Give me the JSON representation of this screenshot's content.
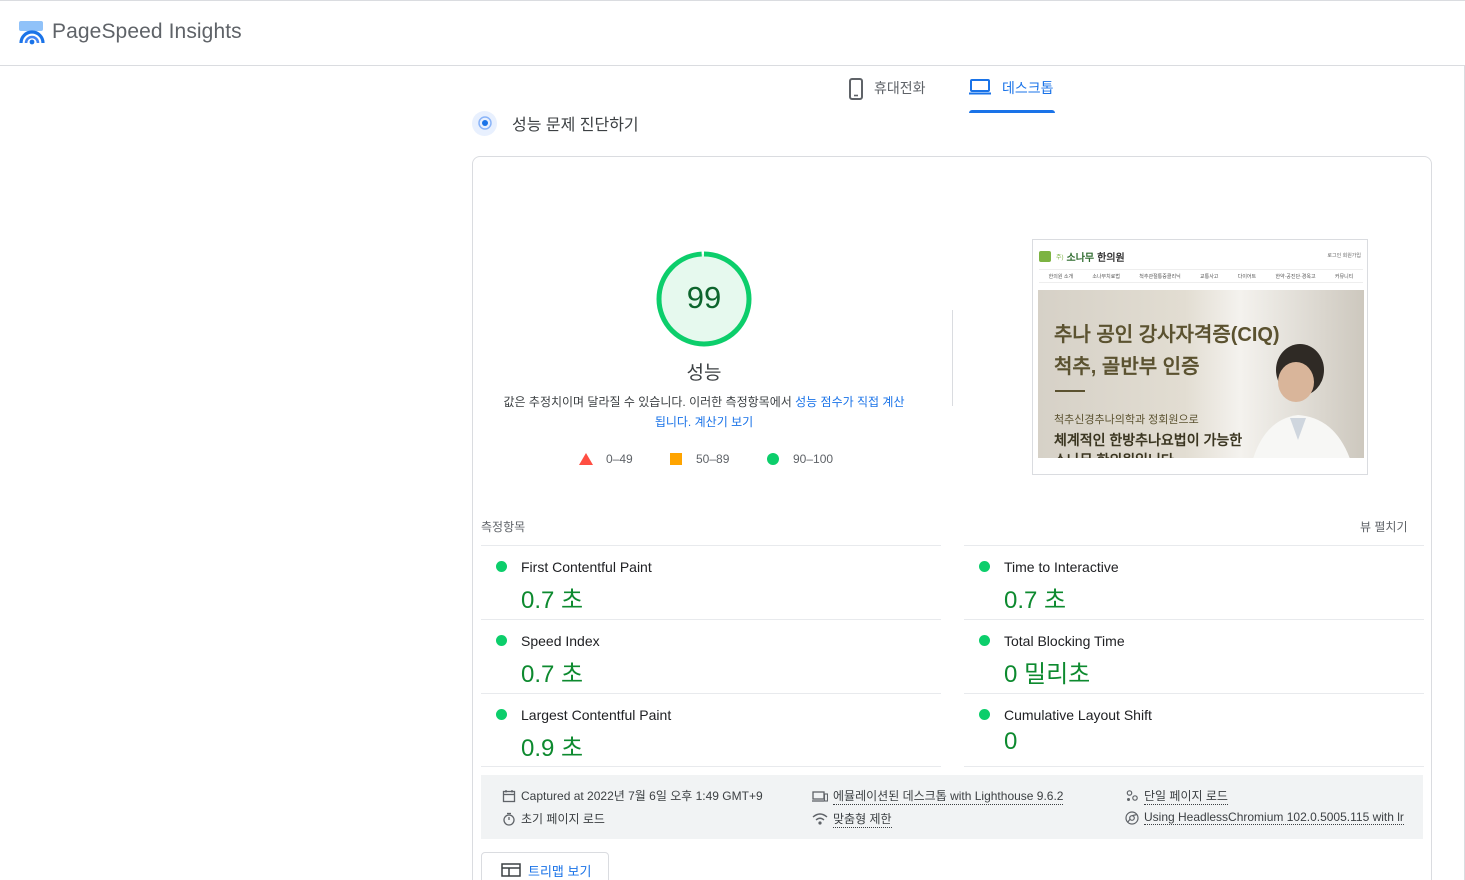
{
  "header": {
    "brand": "PageSpeed Insights"
  },
  "tabs": [
    {
      "label": "휴대전화",
      "icon": "phone-icon",
      "selected": false
    },
    {
      "label": "데스크톱",
      "icon": "laptop-icon",
      "selected": true
    }
  ],
  "diagnose": {
    "title": "성능 문제 진단하기",
    "icon": "lighthouse-icon"
  },
  "score": {
    "value": "99",
    "fraction": 0.99,
    "label": "성능",
    "color": "#0cce6b",
    "note_prefix": "값은 추정치이며 달라질 수 있습니다. 이러한 측정항목에서 ",
    "note_link1": "성능 점수가 직접 계산됩니다.",
    "note_link2": "계산기 보기"
  },
  "legend": [
    {
      "label": "0–49",
      "icon": "triangle-icon",
      "color": "#ff4e42"
    },
    {
      "label": "50–89",
      "icon": "square-icon",
      "color": "#ffa400"
    },
    {
      "label": "90–100",
      "icon": "circle-icon",
      "color": "#0cce6b"
    }
  ],
  "screenshot": {
    "brand_small": "주)",
    "brand_name": "소나무",
    "brand_name2": "한의원",
    "util": "로그인  회원가입",
    "nav": [
      "한의원 소개",
      "소나무치료법",
      "척추관절통증클리닉",
      "교통사고",
      "다이어트",
      "한약·공진단·경옥고",
      "커뮤니티"
    ],
    "hero_line1": "추나 공인 강사자격증(CIQ)",
    "hero_line2": "척추, 골반부 인증",
    "hero_line3": "척추신경추나의학과 정회원으로",
    "hero_line4": "체계적인 한방추나요법이 가능한",
    "hero_line5": "소나무 한의원입니다"
  },
  "metrics": {
    "heading": "측정항목",
    "expand_label": "뷰 펼치기",
    "items": [
      {
        "name": "First Contentful Paint",
        "value": "0.7 초"
      },
      {
        "name": "Time to Interactive",
        "value": "0.7 초"
      },
      {
        "name": "Speed Index",
        "value": "0.7 초"
      },
      {
        "name": "Total Blocking Time",
        "value": "0 밀리초"
      },
      {
        "name": "Largest Contentful Paint",
        "value": "0.9 초"
      },
      {
        "name": "Cumulative Layout Shift",
        "value": "0"
      }
    ]
  },
  "info": {
    "captured": "Captured at 2022년 7월 6일 오후 1:49 GMT+9",
    "initial_load": "초기 페이지 로드",
    "emulated": "에뮬레이션된 데스크톱 with Lighthouse 9.6.2",
    "throttling": "맞춤형 제한",
    "single_load": "단일 페이지 로드",
    "browser": "Using HeadlessChromium 102.0.5005.115 with lr"
  },
  "treemap_label": "트리맵 보기"
}
